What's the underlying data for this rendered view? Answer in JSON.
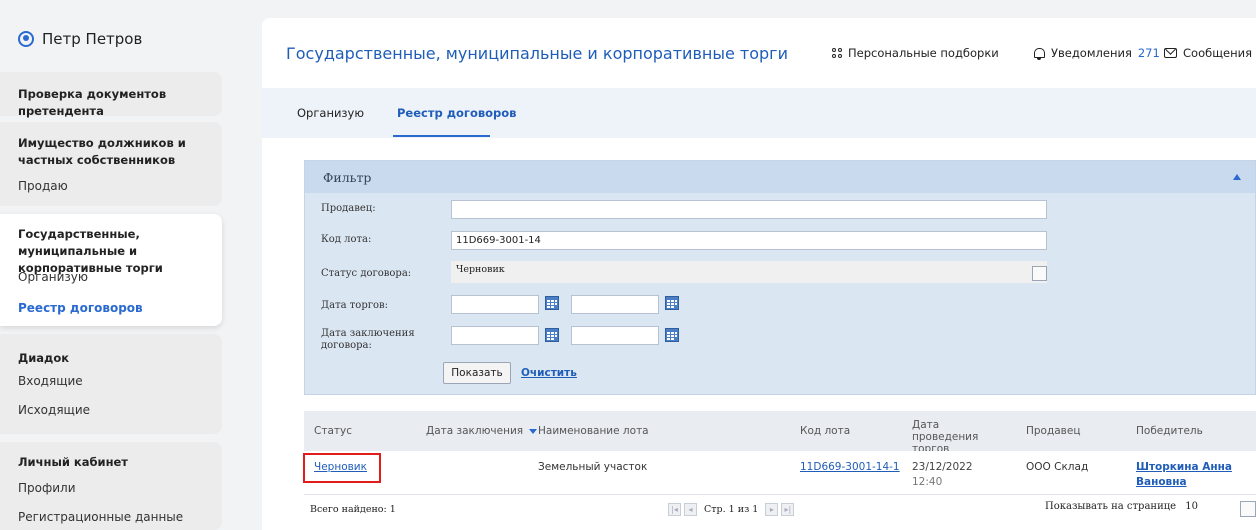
{
  "sidebar": {
    "user_name": "Петр Петров",
    "items": [
      {
        "title": "Проверка документов претендента"
      },
      {
        "title": "Имущество должников и частных собственников",
        "links": [
          "Продаю"
        ]
      },
      {
        "title": "Государственные, муниципальные и корпоративные торги",
        "links": [
          "Организую",
          "Реестр договоров"
        ]
      },
      {
        "title": "Диадок",
        "links": [
          "Входящие",
          "Исходящие"
        ]
      },
      {
        "title": "Личный кабинет",
        "links": [
          "Профили",
          "Регистрационные данные"
        ]
      }
    ]
  },
  "header": {
    "title": "Государственные, муниципальные и корпоративные торги",
    "personal": "Персональные подборки",
    "notifications": "Уведомления",
    "notifications_count": "271",
    "messages": "Сообщения"
  },
  "tabs": [
    "Организую",
    "Реестр договоров"
  ],
  "filter": {
    "title": "Фильтр",
    "seller_label": "Продавец:",
    "seller_value": "",
    "lot_code_label": "Код лота:",
    "lot_code_value": "11D669-3001-14",
    "status_label": "Статус договора:",
    "status_value": "Черновик",
    "auction_date_label": "Дата торгов:",
    "contract_date_label": "Дата заключения договора:",
    "show_button": "Показать",
    "clear_link": "Очистить"
  },
  "table": {
    "columns": [
      "Статус",
      "Дата заключения",
      "Наименование лота",
      "Код лота",
      "Дата проведения торгов",
      "Продавец",
      "Победитель"
    ],
    "rows": [
      {
        "status": "Черновик",
        "contract_date": "",
        "lot_name": "Земельный участок",
        "lot_code": "11D669-3001-14-1",
        "auction_date": "23/12/2022",
        "auction_time": "12:40",
        "seller": "ООО Склад",
        "winner": "Шторкина Анна Вановна"
      }
    ],
    "footer": {
      "total": "Всего найдено: 1",
      "page_label": "Стр.",
      "page_current": "1",
      "page_of": "из",
      "page_total": "1",
      "page_size_label": "Показывать на странице",
      "page_size": "10"
    }
  },
  "colors": {
    "accent": "#1f5db8",
    "highlight": "#e21b1b",
    "filter_bg": "#dbe6f3"
  }
}
